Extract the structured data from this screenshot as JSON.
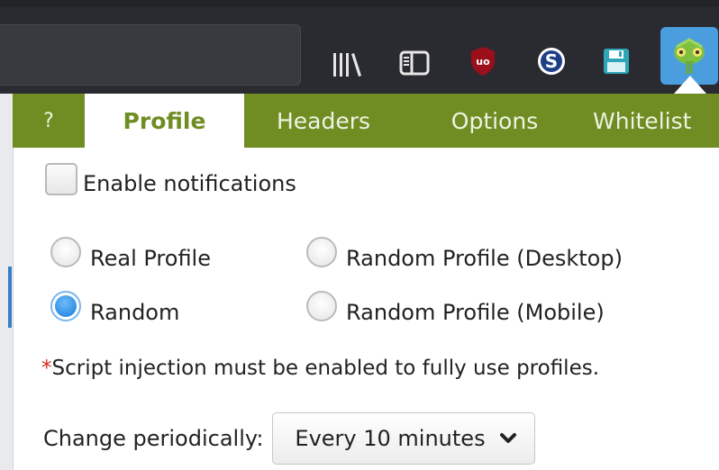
{
  "toolbar": {
    "icons": [
      "library-icon",
      "sidebar-icon",
      "ublock-origin-icon",
      "s-extension-icon",
      "save-disk-icon",
      "chameleon-icon"
    ],
    "chameleon_bg": "#4a9ede"
  },
  "tabs": {
    "help": "?",
    "profile": "Profile",
    "headers": "Headers",
    "options": "Options",
    "whitelist": "Whitelist",
    "active": "Profile",
    "bar_color": "#6f8d23"
  },
  "profile": {
    "enable_notifications_label": "Enable notifications",
    "enable_notifications_checked": false,
    "radios": {
      "real_profile": "Real Profile",
      "random_profile_desktop": "Random Profile (Desktop)",
      "random": "Random",
      "random_profile_mobile": "Random Profile (Mobile)",
      "selected": "Random"
    },
    "note_star": "*",
    "note_text": "Script injection must be enabled to fully use profiles.",
    "change_label": "Change periodically:",
    "change_value": "Every 10 minutes"
  }
}
